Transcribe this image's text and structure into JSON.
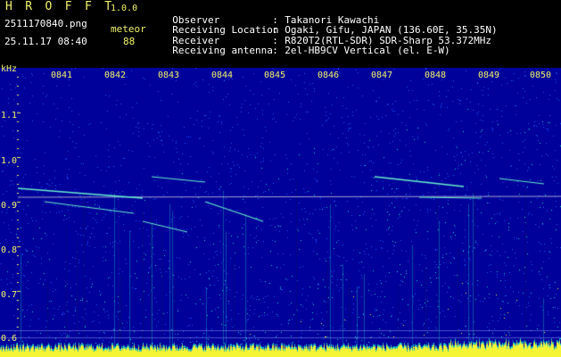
{
  "header": {
    "app_title": "H R O F F T",
    "app_version": "1.0.0",
    "file_name": "2511170840.png",
    "timestamp": "25.11.17 08:40",
    "mode_label": "meteor",
    "count_value": "88"
  },
  "info": [
    {
      "key": "Observer",
      "value": "Takanori Kawachi"
    },
    {
      "key": "Receiving Location",
      "value": "Ogaki, Gifu, JAPAN (136.60E, 35.35N)"
    },
    {
      "key": "Receiver",
      "value": "R820T2(RTL-SDR) SDR-Sharp 53.372MHz"
    },
    {
      "key": "Receiving antenna",
      "value": "2el-HB9CV Vertical (el. E-W)"
    }
  ],
  "plot": {
    "unit_label": "kHz",
    "freq_ticks": [
      "1.1",
      "1.0",
      "0.9",
      "0.8",
      "0.7",
      "0.6"
    ],
    "time_ticks": [
      "0841",
      "0842",
      "0843",
      "0844",
      "0845",
      "0846",
      "0847",
      "0848",
      "0849",
      "0850"
    ],
    "colors": {
      "background": "#00009a",
      "noise_low": "#1e5aff",
      "noise_mid": "#18d6c8",
      "noise_high": "#f5f536",
      "carrier": "#e8e8e8",
      "echo": "#66f0d0",
      "tick": "#f2f26a"
    }
  }
}
